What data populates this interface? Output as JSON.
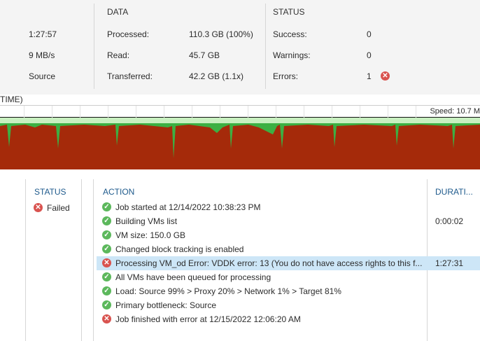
{
  "summary": {
    "left_values": [
      "1:27:57",
      "9 MB/s",
      "Source"
    ],
    "data": {
      "title": "DATA",
      "rows": [
        {
          "label": "Processed:",
          "value": "110.3 GB (100%)"
        },
        {
          "label": "Read:",
          "value": "45.7 GB"
        },
        {
          "label": "Transferred:",
          "value": "42.2 GB (1.1x)"
        }
      ]
    },
    "status": {
      "title": "STATUS",
      "rows": [
        {
          "label": "Success:",
          "value": "0"
        },
        {
          "label": "Warnings:",
          "value": "0"
        },
        {
          "label": "Errors:",
          "value": "1"
        }
      ]
    }
  },
  "chart": {
    "title_fragment": "TIME)",
    "speed_label": "Speed: 10.7 M",
    "colors": {
      "read": "#a52a0a",
      "transfer": "#3cb043",
      "band": "#c8f0c0"
    }
  },
  "log": {
    "status_header": "STATUS",
    "status_value": "Failed",
    "action_header": "ACTION",
    "duration_header": "DURATI...",
    "rows": [
      {
        "status": "ok",
        "action": "Job started at 12/14/2022 10:38:23 PM",
        "duration": ""
      },
      {
        "status": "ok",
        "action": "Building VMs list",
        "duration": "0:00:02"
      },
      {
        "status": "ok",
        "action": "VM size: 150.0 GB",
        "duration": ""
      },
      {
        "status": "ok",
        "action": "Changed block tracking is enabled",
        "duration": ""
      },
      {
        "status": "error",
        "action": "Processing VM_od Error: VDDK error: 13 (You do not have access rights to this f...",
        "duration": "1:27:31",
        "selected": true
      },
      {
        "status": "ok",
        "action": "All VMs have been queued for processing",
        "duration": ""
      },
      {
        "status": "ok",
        "action": "Load: Source 99% > Proxy 20% > Network 1% > Target 81%",
        "duration": ""
      },
      {
        "status": "ok",
        "action": "Primary bottleneck: Source",
        "duration": ""
      },
      {
        "status": "error",
        "action": "Job finished with error at 12/15/2022 12:06:20 AM",
        "duration": ""
      }
    ]
  }
}
